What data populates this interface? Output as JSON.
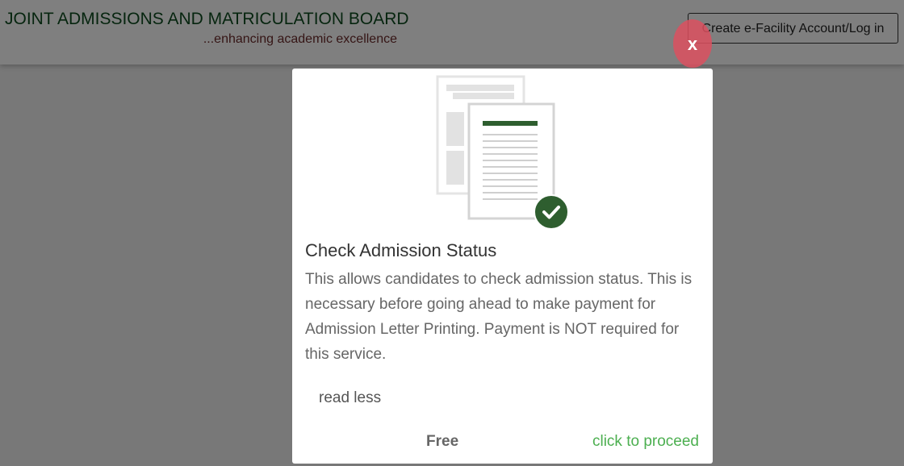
{
  "header": {
    "title": "JOINT ADMISSIONS AND MATRICULATION BOARD",
    "tagline": "...enhancing academic excellence",
    "account_button": "Create e-Facility Account/Log in"
  },
  "modal": {
    "close_label": "x",
    "title": "Check Admission Status",
    "description": "This allows candidates to check admission status. This is necessary before going ahead to make payment for Admission Letter Printing. Payment is NOT required for this service.",
    "read_less": "read less",
    "price": "Free",
    "proceed": "click to proceed",
    "illustration_icon": "document-check-icon"
  },
  "colors": {
    "brand_green": "#0d4a1e",
    "check_green": "#2e5e2f",
    "proceed_green": "#4caf50",
    "close_red": "#dc505f"
  }
}
